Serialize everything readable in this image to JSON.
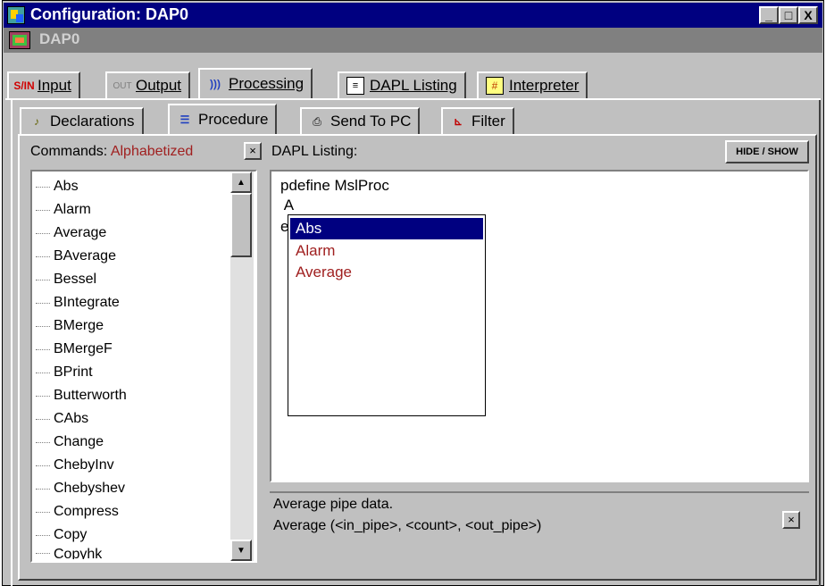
{
  "window": {
    "title": "Configuration: DAP0",
    "subtitle": "DAP0",
    "btn_min": "_",
    "btn_max": "□",
    "btn_close": "X"
  },
  "main_tabs": [
    {
      "label": "Input",
      "icon": "S/IN"
    },
    {
      "label": "Output",
      "icon": "OUT"
    },
    {
      "label": "Processing",
      "icon": ")))"
    },
    {
      "label": "DAPL Listing",
      "icon": "≡"
    },
    {
      "label": "Interpreter",
      "icon": "#"
    }
  ],
  "sub_tabs": [
    {
      "label": "Declarations"
    },
    {
      "label": "Procedure"
    },
    {
      "label": "Send To PC"
    },
    {
      "label": "Filter"
    }
  ],
  "commands": {
    "label": "Commands:",
    "mode": "Alphabetized",
    "close": "×",
    "items": [
      "Abs",
      "Alarm",
      "Average",
      "BAverage",
      "Bessel",
      "BIntegrate",
      "BMerge",
      "BMergeF",
      "BPrint",
      "Butterworth",
      "CAbs",
      "Change",
      "ChebyInv",
      "Chebyshev",
      "Compress",
      "Copy",
      "Copyhk"
    ]
  },
  "listing": {
    "label": "DAPL Listing:",
    "hide_show": "HIDE / SHOW",
    "lines": [
      "pdefine MslProc",
      " A",
      "e"
    ]
  },
  "autocomplete": {
    "items": [
      "Abs",
      "Alarm",
      "Average"
    ],
    "selected": 0
  },
  "hint": {
    "line1": "Average pipe data.",
    "line2": "Average (<in_pipe>, <count>, <out_pipe>)",
    "close": "×"
  },
  "colors": {
    "titlebar": "#000080",
    "accent_text": "#a02020"
  }
}
